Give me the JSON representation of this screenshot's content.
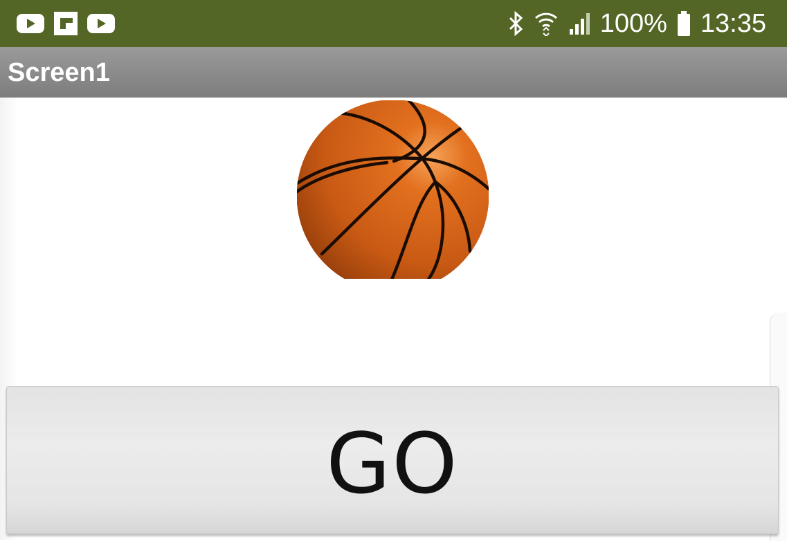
{
  "status_bar": {
    "notification_icons": [
      "youtube-icon",
      "flipboard-icon",
      "youtube-icon"
    ],
    "system_icons": [
      "bluetooth-icon",
      "wifi-icon",
      "signal-icon",
      "battery-icon"
    ],
    "battery": "100%",
    "time": "13:35",
    "background_color": "#536626"
  },
  "app_bar": {
    "title": "Screen1"
  },
  "main": {
    "image": "basketball-image",
    "go_button_label": "GO"
  }
}
